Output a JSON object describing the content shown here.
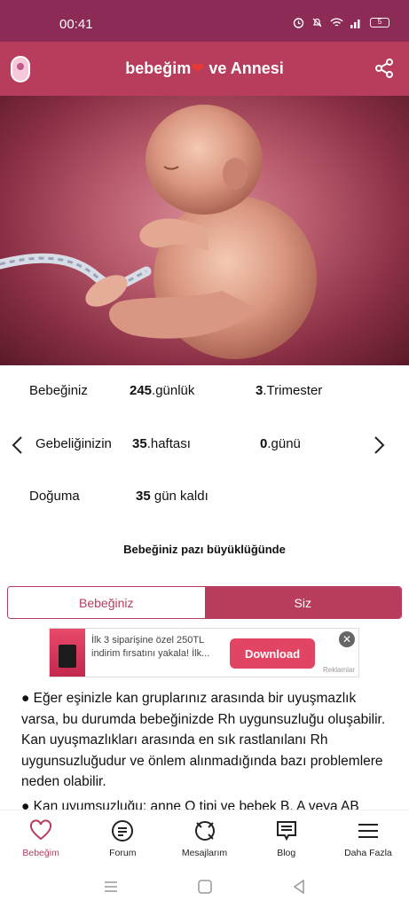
{
  "status_bar": {
    "time": "00:41",
    "battery": "5"
  },
  "header": {
    "title_prefix": "bebeğim",
    "heart": "❤",
    "title_suffix": " ve Annesi"
  },
  "info": {
    "row1": {
      "label": "Bebeğiniz",
      "number": "245",
      "unit": ".günlük",
      "tri_number": "3",
      "tri_unit": ".Trimester"
    },
    "row2": {
      "label": "Gebeliğinizin",
      "week_number": "35",
      "week_unit": ".haftası",
      "day_number": "0",
      "day_unit": ".günü"
    },
    "row3": {
      "label": "Doğuma",
      "number": "35",
      "unit": " gün kaldı"
    }
  },
  "size_caption": "Bebeğiniz pazı büyüklüğünde",
  "tabs": [
    {
      "label": "Bebeğiniz",
      "active": false
    },
    {
      "label": "Siz",
      "active": true
    }
  ],
  "ad": {
    "text": "İlk 3 siparişine özel 250TL indirim fırsatını yakala! İlk...",
    "button": "Download",
    "close": "✕",
    "label": "Reklamlar"
  },
  "article": {
    "p1": "● Eğer eşinizle kan gruplarınız arasında bir uyuşmazlık varsa, bu durumda bebeğinizde Rh uygunsuzluğu oluşabilir. Kan uyuşmazlıkları arasında en sık rastlanılanı Rh uygunsuzluğudur ve önlem alınmadığında bazı problemlere neden olabilir.",
    "p2": "● Kan uyumsuzluğu; anne O tipi ve bebek B, A veya AB"
  },
  "bottom_nav": [
    {
      "label": "Bebeğim",
      "icon": "heart-icon",
      "active": true
    },
    {
      "label": "Forum",
      "icon": "forum-icon",
      "active": false
    },
    {
      "label": "Mesajlarım",
      "icon": "messages-icon",
      "active": false
    },
    {
      "label": "Blog",
      "icon": "blog-icon",
      "active": false
    },
    {
      "label": "Daha Fazla",
      "icon": "menu-icon",
      "active": false
    }
  ],
  "colors": {
    "status_bar": "#8c2b55",
    "brand": "#b83d5c",
    "ad_button": "#e24563"
  }
}
